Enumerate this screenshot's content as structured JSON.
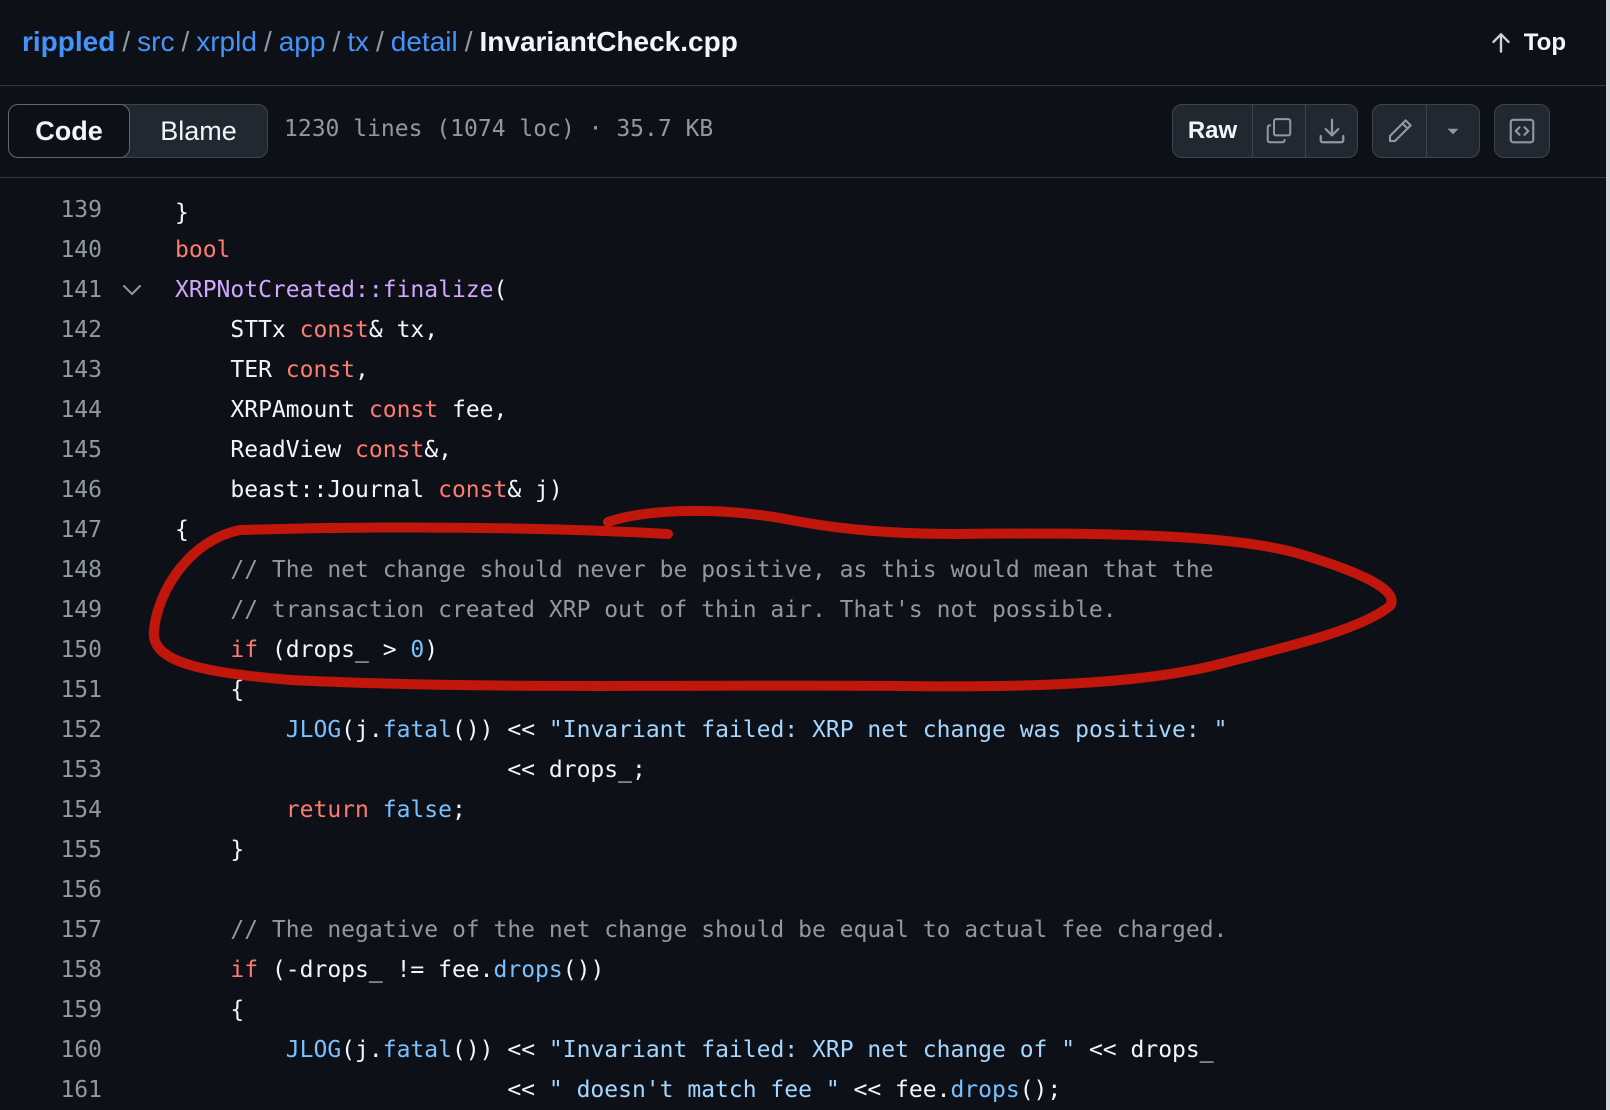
{
  "breadcrumb": {
    "items": [
      "rippled",
      "src",
      "xrpld",
      "app",
      "tx",
      "detail"
    ],
    "separator": "/",
    "file": "InvariantCheck.cpp"
  },
  "top_link": {
    "label": "Top",
    "icon": "arrow-up-icon"
  },
  "toolbar": {
    "code_tab": "Code",
    "blame_tab": "Blame",
    "file_info": "1230 lines (1074 loc) · 35.7 KB",
    "raw_label": "Raw",
    "icons": [
      "copy-icon",
      "download-icon",
      "pencil-icon",
      "triangle-down-icon",
      "code-symbols-icon"
    ]
  },
  "code": {
    "lines": [
      {
        "n": "139",
        "tokens": []
      },
      {
        "n": "140",
        "tokens": [
          {
            "t": "bool",
            "c": "kw"
          }
        ]
      },
      {
        "n": "141",
        "fold": true,
        "tokens": [
          {
            "t": "XRPNotCreated::finalize",
            "c": "fn"
          },
          {
            "t": "(",
            "c": ""
          }
        ]
      },
      {
        "n": "142",
        "tokens": [
          {
            "t": "    STTx ",
            "c": ""
          },
          {
            "t": "const",
            "c": "kw"
          },
          {
            "t": "& tx,",
            "c": ""
          }
        ]
      },
      {
        "n": "143",
        "tokens": [
          {
            "t": "    TER ",
            "c": ""
          },
          {
            "t": "const",
            "c": "kw"
          },
          {
            "t": ",",
            "c": ""
          }
        ]
      },
      {
        "n": "144",
        "tokens": [
          {
            "t": "    XRPAmount ",
            "c": ""
          },
          {
            "t": "const",
            "c": "kw"
          },
          {
            "t": " fee,",
            "c": ""
          }
        ]
      },
      {
        "n": "145",
        "tokens": [
          {
            "t": "    ReadView ",
            "c": ""
          },
          {
            "t": "const",
            "c": "kw"
          },
          {
            "t": "&,",
            "c": ""
          }
        ]
      },
      {
        "n": "146",
        "tokens": [
          {
            "t": "    beast::Journal ",
            "c": ""
          },
          {
            "t": "const",
            "c": "kw"
          },
          {
            "t": "& j)",
            "c": ""
          }
        ]
      },
      {
        "n": "147",
        "tokens": [
          {
            "t": "{",
            "c": ""
          }
        ]
      },
      {
        "n": "148",
        "tokens": [
          {
            "t": "    // The net change should never be positive, as this would mean that the",
            "c": "cm"
          }
        ]
      },
      {
        "n": "149",
        "tokens": [
          {
            "t": "    // transaction created XRP out of thin air. That's not possible.",
            "c": "cm"
          }
        ]
      },
      {
        "n": "150",
        "tokens": [
          {
            "t": "    ",
            "c": ""
          },
          {
            "t": "if",
            "c": "kw"
          },
          {
            "t": " (drops_ > ",
            "c": ""
          },
          {
            "t": "0",
            "c": "ent"
          },
          {
            "t": ")",
            "c": ""
          }
        ]
      },
      {
        "n": "151",
        "tokens": [
          {
            "t": "    {",
            "c": ""
          }
        ]
      },
      {
        "n": "152",
        "tokens": [
          {
            "t": "        ",
            "c": ""
          },
          {
            "t": "JLOG",
            "c": "ent"
          },
          {
            "t": "(j.",
            "c": ""
          },
          {
            "t": "fatal",
            "c": "ent"
          },
          {
            "t": "()) << ",
            "c": ""
          },
          {
            "t": "\"Invariant failed: XRP net change was positive: \"",
            "c": "str"
          }
        ]
      },
      {
        "n": "153",
        "tokens": [
          {
            "t": "                        << drops_;",
            "c": ""
          }
        ]
      },
      {
        "n": "154",
        "tokens": [
          {
            "t": "        ",
            "c": ""
          },
          {
            "t": "return",
            "c": "kw"
          },
          {
            "t": " ",
            "c": ""
          },
          {
            "t": "false",
            "c": "ent"
          },
          {
            "t": ";",
            "c": ""
          }
        ]
      },
      {
        "n": "155",
        "tokens": [
          {
            "t": "    }",
            "c": ""
          }
        ]
      },
      {
        "n": "156",
        "tokens": []
      },
      {
        "n": "157",
        "tokens": [
          {
            "t": "    // The negative of the net change should be equal to actual fee charged.",
            "c": "cm"
          }
        ]
      },
      {
        "n": "158",
        "tokens": [
          {
            "t": "    ",
            "c": ""
          },
          {
            "t": "if",
            "c": "kw"
          },
          {
            "t": " (-drops_ != fee.",
            "c": ""
          },
          {
            "t": "drops",
            "c": "ent"
          },
          {
            "t": "())",
            "c": ""
          }
        ]
      },
      {
        "n": "159",
        "tokens": [
          {
            "t": "    {",
            "c": ""
          }
        ]
      },
      {
        "n": "160",
        "tokens": [
          {
            "t": "        ",
            "c": ""
          },
          {
            "t": "JLOG",
            "c": "ent"
          },
          {
            "t": "(j.",
            "c": ""
          },
          {
            "t": "fatal",
            "c": "ent"
          },
          {
            "t": "()) << ",
            "c": ""
          },
          {
            "t": "\"Invariant failed: XRP net change of \"",
            "c": "str"
          },
          {
            "t": " << drops_",
            "c": ""
          }
        ]
      },
      {
        "n": "161",
        "tokens": [
          {
            "t": "                        << ",
            "c": ""
          },
          {
            "t": "\" doesn't match fee \"",
            "c": "str"
          },
          {
            "t": " << fee.",
            "c": ""
          },
          {
            "t": "drops",
            "c": "ent"
          },
          {
            "t": "();",
            "c": ""
          }
        ]
      }
    ]
  },
  "colors": {
    "background": "#0d1117",
    "link": "#4493f8",
    "keyword": "#ff7b72",
    "function": "#d2a8ff",
    "constant": "#79c0ff",
    "string": "#a5d6ff",
    "comment": "#9198a1",
    "annotation": "#c0160c"
  },
  "annotation": {
    "type": "hand-drawn red loop around lines 148-150"
  }
}
